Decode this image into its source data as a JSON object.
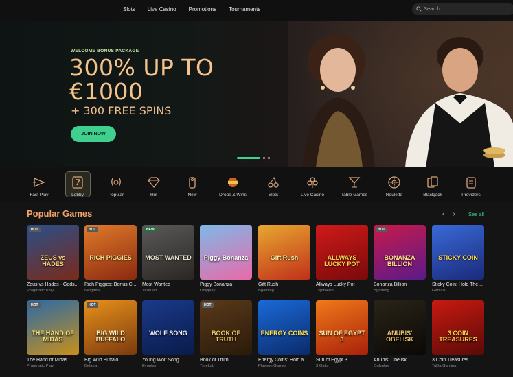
{
  "nav": {
    "links": [
      "Slots",
      "Live Casino",
      "Promotions",
      "Tournaments"
    ],
    "search_placeholder": "Search"
  },
  "hero": {
    "kicker": "WELCOME BONUS PACKAGE",
    "headline_line1": "300% UP TO",
    "headline_line2": "€1000",
    "subheadline": "+ 300 FREE SPINS",
    "cta": "JOIN NOW",
    "slide_count": 3,
    "active_slide": 1
  },
  "categories": [
    {
      "label": "Fast Play",
      "icon": "play-arrow-icon"
    },
    {
      "label": "Lobby",
      "icon": "slot-seven-icon",
      "selected": true
    },
    {
      "label": "Popular",
      "icon": "laurel-icon"
    },
    {
      "label": "Hot",
      "icon": "diamond-icon"
    },
    {
      "label": "New",
      "icon": "door-hanger-icon"
    },
    {
      "label": "Drops & Wins",
      "icon": "drops-wins-icon"
    },
    {
      "label": "Slots",
      "icon": "cherries-icon"
    },
    {
      "label": "Live Casino",
      "icon": "club-suit-icon"
    },
    {
      "label": "Table Games",
      "icon": "cocktail-icon"
    },
    {
      "label": "Roulette",
      "icon": "roulette-icon"
    },
    {
      "label": "Blackjack",
      "icon": "playing-cards-icon"
    },
    {
      "label": "Providers",
      "icon": "providers-icon"
    }
  ],
  "popular": {
    "title": "Popular Games",
    "see_all": "See all",
    "prev_arrow": "‹",
    "next_arrow": "›",
    "games_row1": [
      {
        "name": "Zeus vs Hades - Gods...",
        "provider": "Pragmatic Play",
        "badge": "HOT",
        "art": "ZEUS vs HADES",
        "bg": [
          "#2a4f8a",
          "#7a2a1a"
        ],
        "fg": "#f0d27a"
      },
      {
        "name": "Rich Piggies: Bonus C...",
        "provider": "Netgame",
        "badge": "HOT",
        "art": "RICH PIGGIES",
        "bg": [
          "#e07a2a",
          "#8a2a10"
        ],
        "fg": "#ffe28a"
      },
      {
        "name": "Most Wanted",
        "provider": "TrueLab",
        "badge": "NEW",
        "art": "MOST WANTED",
        "bg": [
          "#5a5a5a",
          "#2a2622"
        ],
        "fg": "#e8e0d0"
      },
      {
        "name": "Piggy Bonanza",
        "provider": "Onlyplay",
        "badge": "",
        "art": "Piggy Bonanza",
        "bg": [
          "#7fb8e8",
          "#e86aa8"
        ],
        "fg": "#ffffff"
      },
      {
        "name": "Gift Rush",
        "provider": "Bgaming",
        "badge": "",
        "art": "Gift Rush",
        "bg": [
          "#e8a830",
          "#c0301a"
        ],
        "fg": "#fff2a8"
      },
      {
        "name": "Allways Lucky Pot",
        "provider": "1spin4win",
        "badge": "",
        "art": "ALLWAYS LUCKY POT",
        "bg": [
          "#d01a1a",
          "#7a0a0a"
        ],
        "fg": "#ffd84a"
      },
      {
        "name": "Bonanza Billion",
        "provider": "Bgaming",
        "badge": "HOT",
        "art": "BONANZA BILLION",
        "bg": [
          "#c81a4a",
          "#5a1a8a"
        ],
        "fg": "#ffe08a"
      },
      {
        "name": "Sticky Coin: Hold The ...",
        "provider": "Gamzix",
        "badge": "",
        "art": "STICKY COIN",
        "bg": [
          "#3a6ad8",
          "#1a2a7a"
        ],
        "fg": "#ffd84a"
      }
    ],
    "games_row2": [
      {
        "name": "The Hand of Midas",
        "provider": "Pragmatic Play",
        "badge": "HOT",
        "art": "THE HAND OF MIDAS",
        "bg": [
          "#2a6aa8",
          "#c8901a"
        ],
        "fg": "#ffe27a"
      },
      {
        "name": "Big Wild Buffalo",
        "provider": "Belatra",
        "badge": "HOT",
        "art": "BIG WILD BUFFALO",
        "bg": [
          "#e8901a",
          "#7a3a10"
        ],
        "fg": "#fff0c0"
      },
      {
        "name": "Young Wolf Song",
        "provider": "Evoplay",
        "badge": "",
        "art": "WOLF SONG",
        "bg": [
          "#1a3a8a",
          "#0a1a4a"
        ],
        "fg": "#e8f0ff"
      },
      {
        "name": "Book of Truth",
        "provider": "TrueLab",
        "badge": "HOT",
        "art": "BOOK OF TRUTH",
        "bg": [
          "#5a3a1a",
          "#2a1a0a"
        ],
        "fg": "#f0c86a"
      },
      {
        "name": "Energy Coins: Hold a...",
        "provider": "Playson Games",
        "badge": "",
        "art": "ENERGY COINS",
        "bg": [
          "#1a6ad8",
          "#0a2a6a"
        ],
        "fg": "#ffe04a"
      },
      {
        "name": "Sun of Egypt 3",
        "provider": "3 Oaks",
        "badge": "",
        "art": "SUN OF EGYPT 3",
        "bg": [
          "#f07a1a",
          "#a8200a"
        ],
        "fg": "#ffe6a0"
      },
      {
        "name": "Anubis' Obelisk",
        "provider": "Onlyplay",
        "badge": "",
        "art": "ANUBIS' OBELISK",
        "bg": [
          "#2a2418",
          "#0a0806"
        ],
        "fg": "#e8c26a"
      },
      {
        "name": "3 Coin Treasures",
        "provider": "TaDa Gaming",
        "badge": "",
        "art": "3 COIN TREASURES",
        "bg": [
          "#c81a10",
          "#5a0a08"
        ],
        "fg": "#ffd84a"
      }
    ]
  },
  "colors": {
    "accent": "#3fcf8e",
    "headline": "#f4c48c",
    "section_title": "#f2a46a",
    "background": "#141414"
  }
}
